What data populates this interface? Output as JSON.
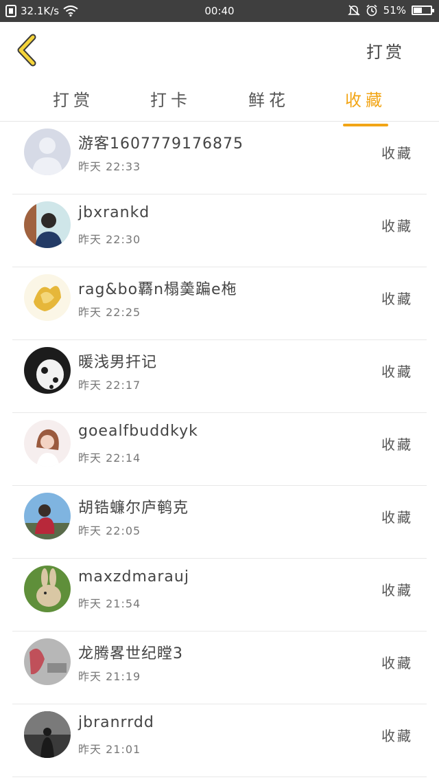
{
  "status_bar": {
    "network_speed": "32.1K/s",
    "time": "00:40",
    "battery": "51%",
    "battery_level": 0.51
  },
  "header": {
    "back_icon": "chevron-left-icon",
    "action_label": "打赏"
  },
  "tabs": [
    {
      "label": "打赏"
    },
    {
      "label": "打卡"
    },
    {
      "label": "鲜花"
    },
    {
      "label": "收藏"
    }
  ],
  "active_tab": 3,
  "accent_color": "#f2a516",
  "list": [
    {
      "name": "游客1607779176875",
      "time": "昨天 22:33",
      "action": "收藏"
    },
    {
      "name": "jbxrankd",
      "time": "昨天 22:30",
      "action": "收藏"
    },
    {
      "name": "rag&bo覉n榻羮蹁e柂",
      "time": "昨天 22:25",
      "action": "收藏"
    },
    {
      "name": "暖浅男扞记",
      "time": "昨天 22:17",
      "action": "收藏"
    },
    {
      "name": "goealfbuddkyk",
      "time": "昨天 22:14",
      "action": "收藏"
    },
    {
      "name": "胡锆蠊尔庐鹌克",
      "time": "昨天 22:05",
      "action": "收藏"
    },
    {
      "name": "maxzdmarauj",
      "time": "昨天 21:54",
      "action": "收藏"
    },
    {
      "name": "龙腾畧世纪瞠3",
      "time": "昨天 21:19",
      "action": "收藏"
    },
    {
      "name": "jbranrrdd",
      "time": "昨天 21:01",
      "action": "收藏"
    }
  ]
}
